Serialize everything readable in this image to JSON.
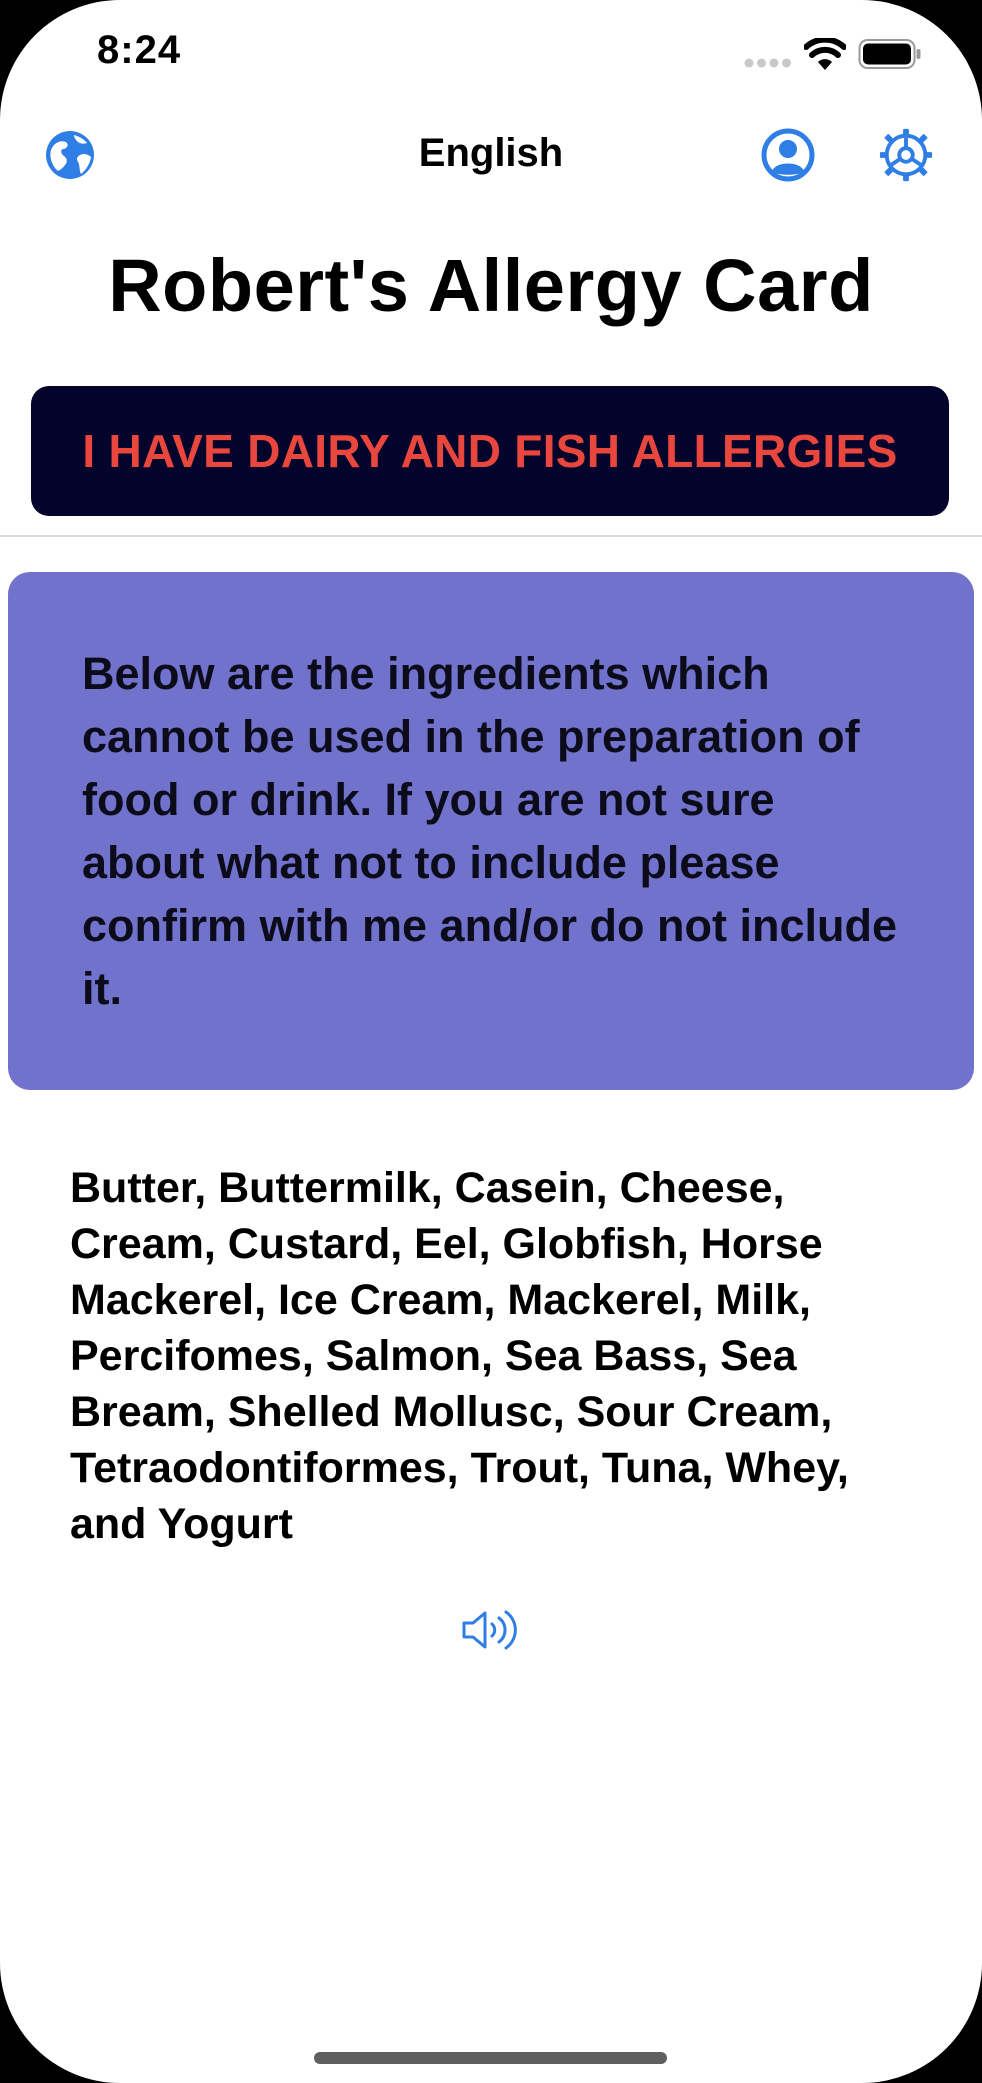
{
  "status_bar": {
    "time": "8:24"
  },
  "nav": {
    "title": "English",
    "icons": {
      "left": "globe-icon",
      "profile": "person-circle-icon",
      "settings": "gear-icon"
    },
    "accent_color": "#2f7ee6"
  },
  "page": {
    "title": "Robert's Allergy Card",
    "banner_text": "I HAVE DAIRY AND FISH ALLERGIES",
    "banner_bg": "#03032c",
    "banner_text_color": "#e9473d",
    "info_card_bg": "#7172cc",
    "info_text": "Below are the ingredients which cannot be used in the preparation of food or drink. If you are not sure about what not to include please confirm with me and/or do not include it.",
    "ingredients_text": "Butter, Buttermilk, Casein, Cheese, Cream, Custard, Eel, Globfish, Horse Mackerel, Ice Cream, Mackerel, Milk, Percifomes, Salmon, Sea Bass, Sea Bream, Shelled Mollusc, Sour Cream, Tetraodontiformes, Trout, Tuna, Whey, and Yogurt",
    "speak_icon": "speaker-wave-icon"
  }
}
